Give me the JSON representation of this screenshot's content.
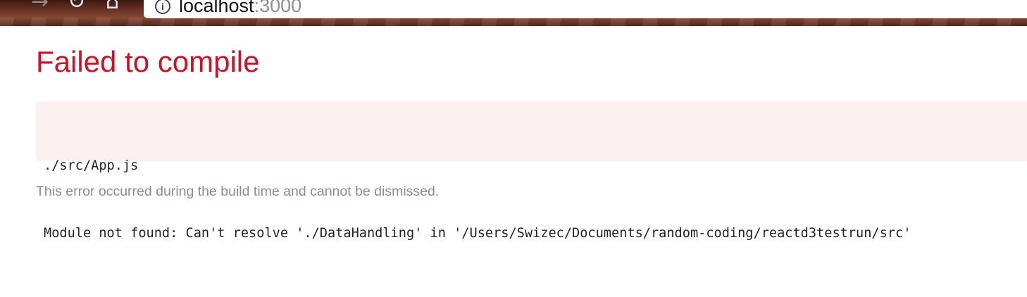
{
  "browser": {
    "url_host": "localhost",
    "url_port": ":3000",
    "info_glyph": "i",
    "forward_glyph": "→",
    "reload_glyph": "↻",
    "home_glyph": "⌂"
  },
  "overlay": {
    "title": "Failed to compile",
    "file": "./src/App.js",
    "message": "Module not found: Can't resolve './DataHandling' in '/Users/Swizec/Documents/random-coding/reactd3testrun/src'",
    "note": "This error occurred during the build time and cannot be dismissed."
  },
  "colors": {
    "title_red": "#ce1126",
    "box_background": "#fcf0f1",
    "note_gray": "#878e91"
  }
}
